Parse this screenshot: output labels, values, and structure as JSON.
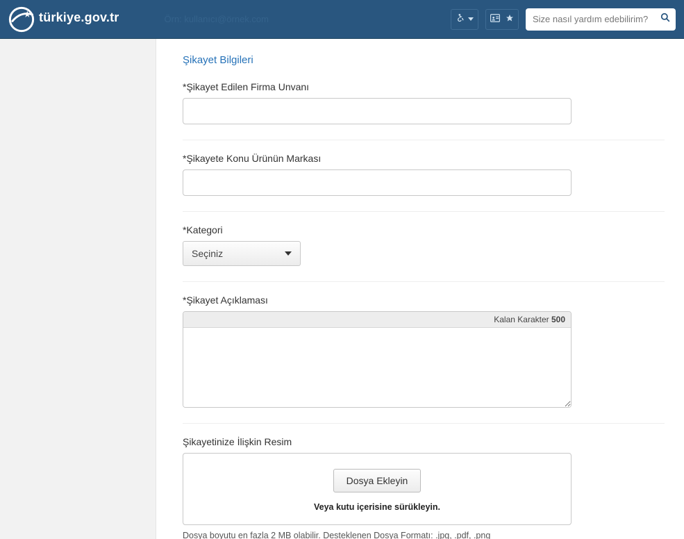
{
  "header": {
    "brand": "türkiye.gov.tr",
    "hidden_search_text": "Örn: kullanıcı@örnek.com",
    "help_placeholder": "Size nasıl yardım edebilirim?"
  },
  "section_title": "Şikayet Bilgileri",
  "fields": {
    "firma": {
      "label": "*Şikayet Edilen Firma Unvanı",
      "value": ""
    },
    "marka": {
      "label": "*Şikayete Konu Ürünün Markası",
      "value": ""
    },
    "kategori": {
      "label": "*Kategori",
      "selected": "Seçiniz"
    },
    "aciklama": {
      "label": "*Şikayet Açıklaması",
      "remaining_label": "Kalan Karakter ",
      "remaining_count": "500",
      "value": ""
    },
    "resim": {
      "label": "Şikayetinize İlişkin Resim",
      "button": "Dosya Ekleyin",
      "drag_hint": "Veya kutu içerisine sürükleyin.",
      "note": "Dosya boyutu en fazla 2 MB olabilir. Desteklenen Dosya Formatı: .jpg, .pdf, .png"
    }
  }
}
